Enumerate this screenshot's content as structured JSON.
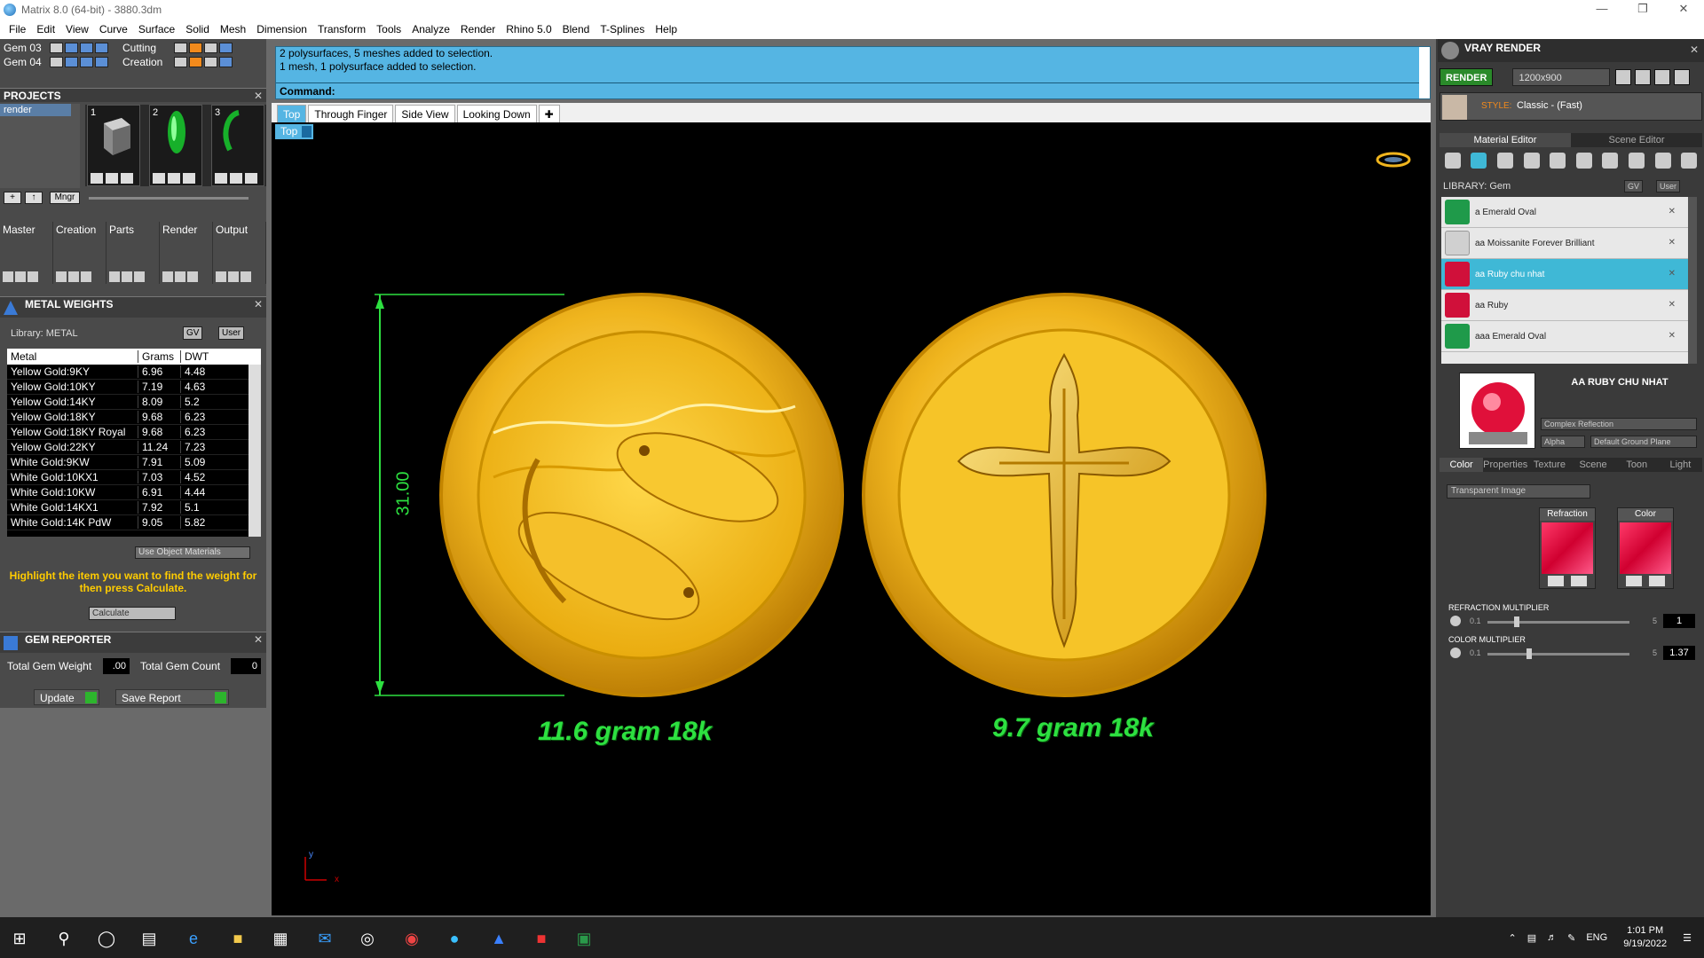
{
  "window": {
    "title": "Matrix 8.0 (64-bit) - 3880.3dm"
  },
  "menu": [
    "File",
    "Edit",
    "View",
    "Curve",
    "Surface",
    "Solid",
    "Mesh",
    "Dimension",
    "Transform",
    "Tools",
    "Analyze",
    "Render",
    "Rhino 5.0",
    "Blend",
    "T-Splines",
    "Help"
  ],
  "layers": [
    {
      "label": "Gem 03",
      "label2": "Cutting"
    },
    {
      "label": "Gem 04",
      "label2": "Creation"
    }
  ],
  "projects": {
    "title": "PROJECTS",
    "selected": "render",
    "thumbs": [
      "1",
      "2",
      "3"
    ],
    "mngr": "Mngr"
  },
  "tabs": [
    "Master",
    "Creation",
    "Parts",
    "Render",
    "Output"
  ],
  "metal_weights": {
    "title": "METAL WEIGHTS",
    "library": "Library: METAL",
    "gv": "GV",
    "user": "User",
    "headers": [
      "Metal",
      "Grams",
      "DWT"
    ],
    "rows": [
      [
        "Yellow Gold:9KY",
        "6.96",
        "4.48"
      ],
      [
        "Yellow Gold:10KY",
        "7.19",
        "4.63"
      ],
      [
        "Yellow Gold:14KY",
        "8.09",
        "5.2"
      ],
      [
        "Yellow Gold:18KY",
        "9.68",
        "6.23"
      ],
      [
        "Yellow Gold:18KY Royal",
        "9.68",
        "6.23"
      ],
      [
        "Yellow Gold:22KY",
        "11.24",
        "7.23"
      ],
      [
        "White Gold:9KW",
        "7.91",
        "5.09"
      ],
      [
        "White Gold:10KX1",
        "7.03",
        "4.52"
      ],
      [
        "White Gold:10KW",
        "6.91",
        "4.44"
      ],
      [
        "White Gold:14KX1",
        "7.92",
        "5.1"
      ],
      [
        "White Gold:14K PdW",
        "9.05",
        "5.82"
      ]
    ],
    "use_object_materials": "Use Object Materials",
    "hint": "Highlight the item you want to find the weight for then press Calculate.",
    "calculate": "Calculate"
  },
  "gem_reporter": {
    "title": "GEM REPORTER",
    "total_weight_label": "Total Gem Weight",
    "total_weight_value": ".00",
    "total_count_label": "Total Gem Count",
    "total_count_value": "0",
    "update": "Update",
    "save_report": "Save Report"
  },
  "command": {
    "history": [
      "2 polysurfaces, 5 meshes added to selection.",
      "1 mesh, 1 polysurface added to selection."
    ],
    "prompt": "Command:"
  },
  "viewport": {
    "tabs": [
      "Top",
      "Through Finger",
      "Side View",
      "Looking Down"
    ],
    "active_tab": "Top",
    "label": "Top",
    "dimension": "31.00",
    "coin1_label": "11.6 gram 18k",
    "coin2_label": "9.7 gram 18k",
    "axis_y": "y",
    "axis_x": "x"
  },
  "vray": {
    "title": "VRAY RENDER",
    "render": "RENDER",
    "resolution": "1200x900",
    "style_label": "STYLE:",
    "style_value": "Classic - (Fast)",
    "tabs": [
      "Material Editor",
      "Scene Editor"
    ],
    "library": "LIBRARY: Gem",
    "gv": "GV",
    "user": "User",
    "materials": [
      {
        "name": "a Emerald Oval",
        "color": "#1f9a4a"
      },
      {
        "name": "aa Moissanite Forever Brilliant",
        "color": "#d0d0d0"
      },
      {
        "name": "aa Ruby chu nhat",
        "color": "#d0103a",
        "selected": true
      },
      {
        "name": "aa Ruby",
        "color": "#d0103a"
      },
      {
        "name": "aaa Emerald Oval",
        "color": "#1f9a4a"
      }
    ],
    "material_name": "AA RUBY CHU NHAT",
    "reflection": "Complex Reflection",
    "alpha": "Alpha",
    "ground": "Default Ground Plane",
    "subtabs": [
      "Color",
      "Properties",
      "Texture",
      "Scene",
      "Toon",
      "Light"
    ],
    "transparent": "Transparent Image",
    "swatch1": "Refraction",
    "swatch2": "Color",
    "refraction_mult_label": "REFRACTION MULTIPLIER",
    "refraction_min": "0.1",
    "refraction_max": "5",
    "refraction_value": "1",
    "color_mult_label": "COLOR MULTIPLIER",
    "color_min": "0.1",
    "color_max": "5",
    "color_value": "1.37"
  },
  "taskbar": {
    "lang": "ENG",
    "time": "1:01 PM",
    "date": "9/19/2022"
  }
}
